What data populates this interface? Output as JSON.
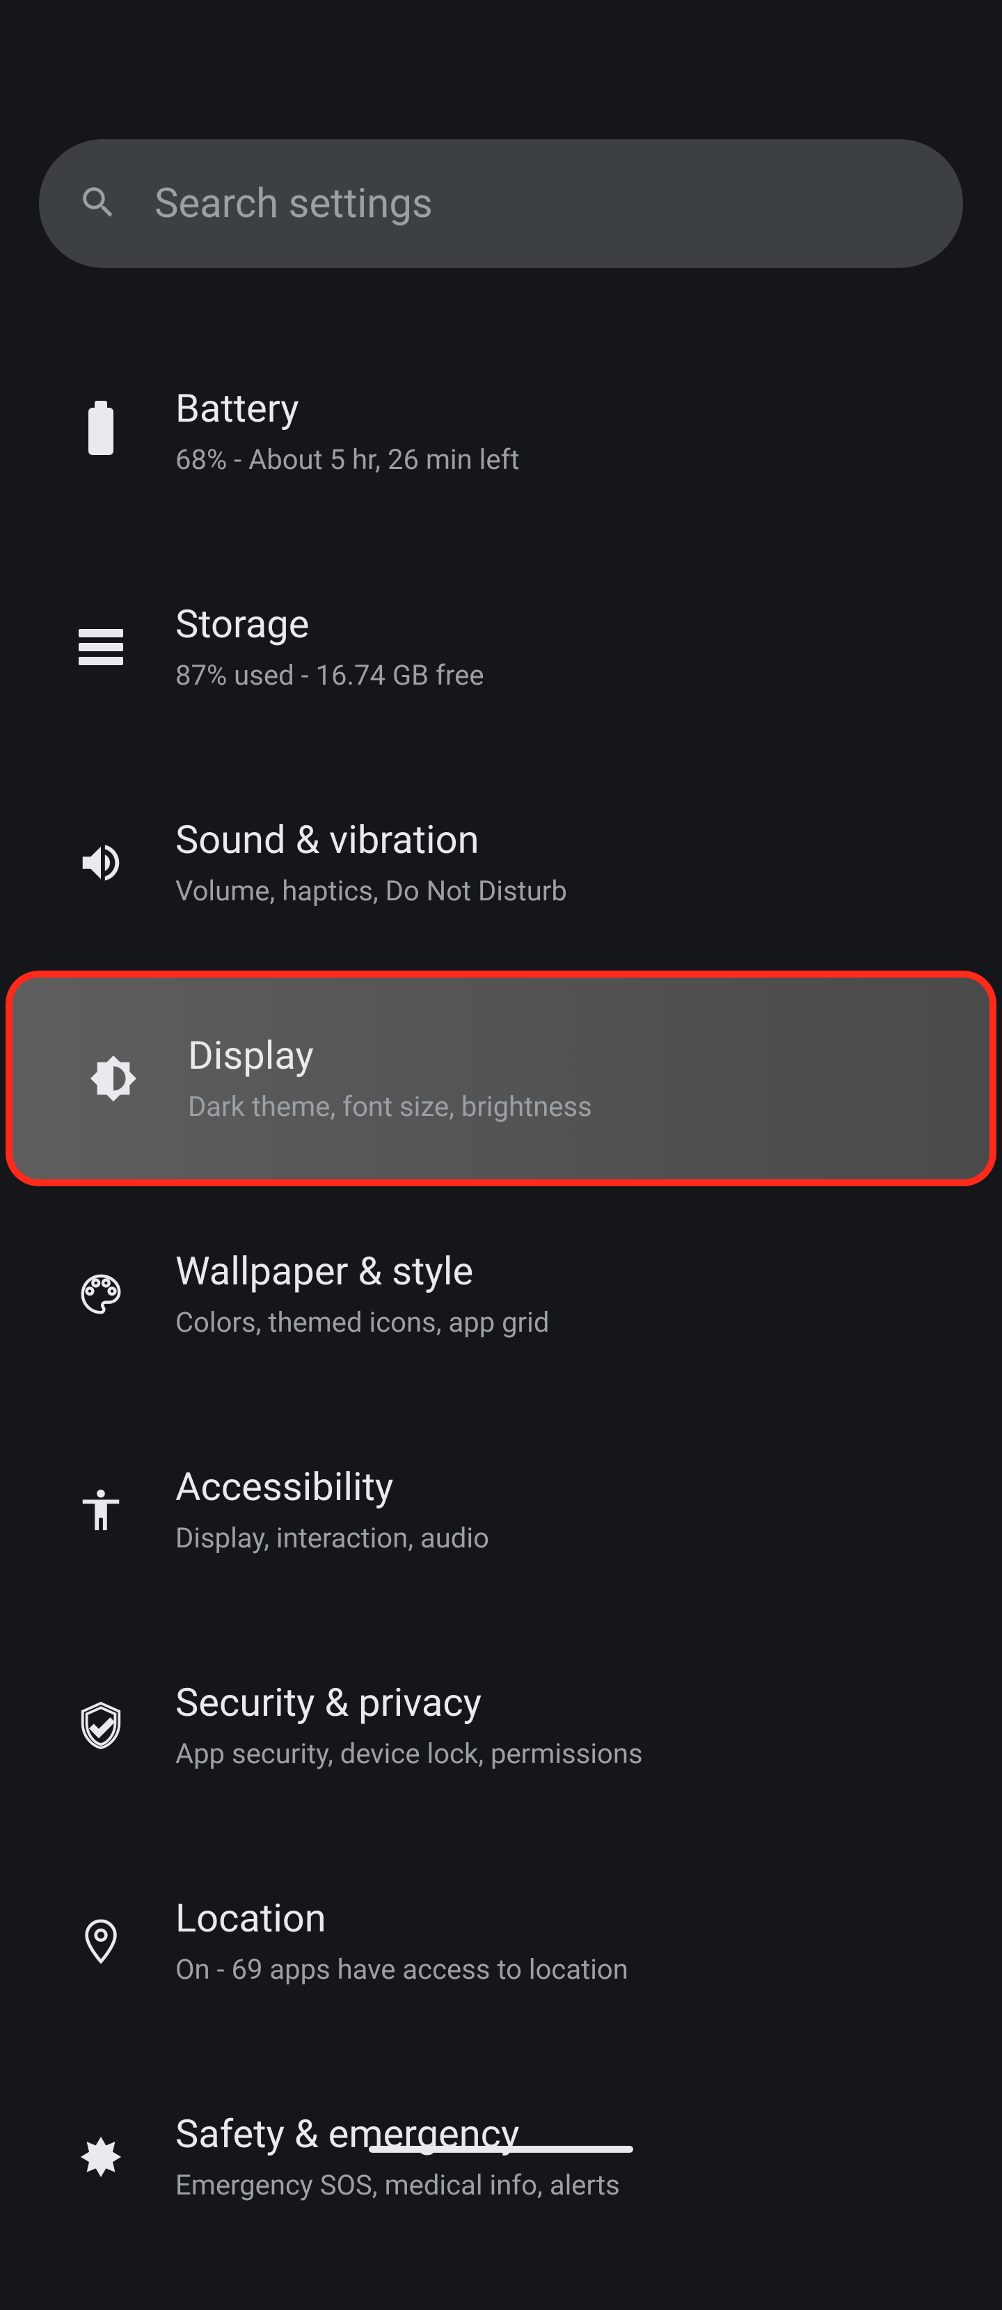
{
  "search": {
    "placeholder": "Search settings"
  },
  "items": [
    {
      "id": "battery",
      "title": "Battery",
      "subtitle": "68% - About 5 hr, 26 min left",
      "icon": "battery-icon"
    },
    {
      "id": "storage",
      "title": "Storage",
      "subtitle": "87% used - 16.74 GB free",
      "icon": "storage-icon"
    },
    {
      "id": "sound",
      "title": "Sound & vibration",
      "subtitle": "Volume, haptics, Do Not Disturb",
      "icon": "volume-icon"
    },
    {
      "id": "display",
      "title": "Display",
      "subtitle": "Dark theme, font size, brightness",
      "icon": "brightness-icon",
      "highlighted": true
    },
    {
      "id": "wallpaper",
      "title": "Wallpaper & style",
      "subtitle": "Colors, themed icons, app grid",
      "icon": "palette-icon"
    },
    {
      "id": "accessibility",
      "title": "Accessibility",
      "subtitle": "Display, interaction, audio",
      "icon": "accessibility-icon"
    },
    {
      "id": "security",
      "title": "Security & privacy",
      "subtitle": "App security, device lock, permissions",
      "icon": "shield-icon"
    },
    {
      "id": "location",
      "title": "Location",
      "subtitle": "On - 69 apps have access to location",
      "icon": "location-icon"
    },
    {
      "id": "safety",
      "title": "Safety & emergency",
      "subtitle": "Emergency SOS, medical info, alerts",
      "icon": "medical-icon"
    }
  ]
}
